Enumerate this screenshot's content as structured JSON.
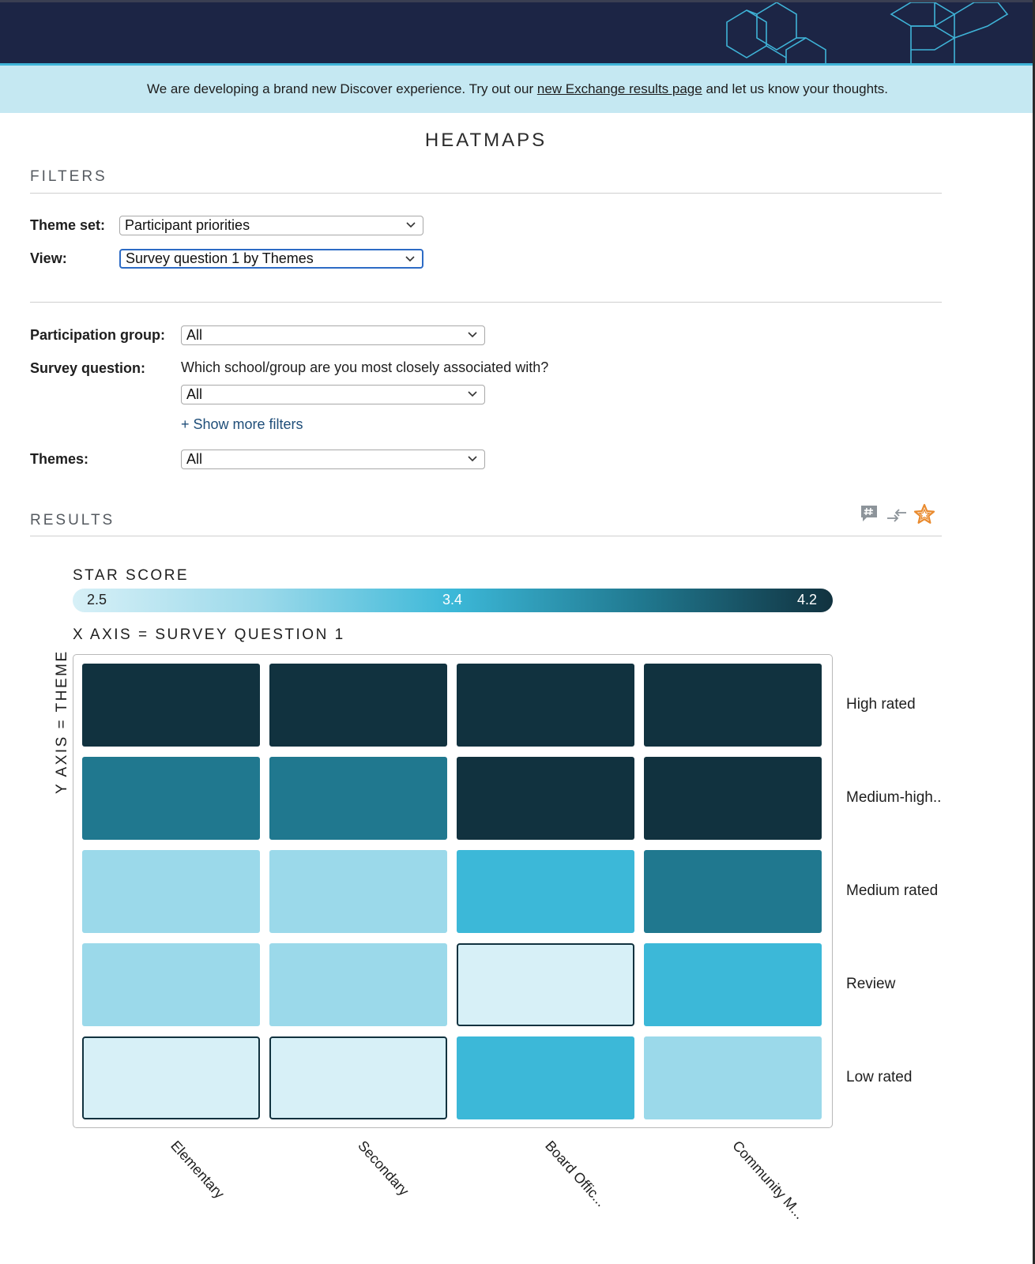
{
  "banner": {
    "text_before": "We are developing a brand new Discover experience. Try out our ",
    "link_text": "new Exchange results page",
    "text_after": " and let us know your thoughts."
  },
  "page": {
    "title": "HEATMAPS"
  },
  "filters": {
    "heading": "FILTERS",
    "theme_set": {
      "label": "Theme set:",
      "value": "Participant priorities"
    },
    "view": {
      "label": "View:",
      "value": "Survey question 1 by Themes"
    },
    "participation_group": {
      "label": "Participation group:",
      "value": "All"
    },
    "survey_question": {
      "label": "Survey question:",
      "question": "Which school/group are you most closely associated with?",
      "value": "All"
    },
    "show_more": "+ Show more filters",
    "themes": {
      "label": "Themes:",
      "value": "All"
    }
  },
  "results": {
    "heading": "RESULTS",
    "icons": [
      "comment-hashtag-icon",
      "swap-arrows-icon",
      "star-icon"
    ]
  },
  "colors": {
    "header_navy": "#1c2545",
    "banner_bg": "#c5e8f2",
    "star_orange": "#e98a2e",
    "scale": [
      "#d7f0f7",
      "#9bd9ea",
      "#3cb8d8",
      "#20788f",
      "#11323f"
    ]
  },
  "chart_data": {
    "type": "heatmap",
    "title": "STAR SCORE",
    "scale_labels": {
      "min": "2.5",
      "mid": "3.4",
      "max": "4.2"
    },
    "scale_range": [
      2.5,
      4.2
    ],
    "xlabel": "X AXIS = SURVEY QUESTION 1",
    "ylabel": "Y AXIS = THEME",
    "x": [
      "Elementary",
      "Secondary",
      "Board Offic...",
      "Community M..."
    ],
    "y": [
      "High rated",
      "Medium-high..",
      "Medium rated",
      "Review",
      "Low rated"
    ],
    "values": [
      [
        4.2,
        4.2,
        4.2,
        4.2
      ],
      [
        3.8,
        3.8,
        4.2,
        4.2
      ],
      [
        3.0,
        3.0,
        3.4,
        3.8
      ],
      [
        3.0,
        3.0,
        2.5,
        3.4
      ],
      [
        2.5,
        2.5,
        3.4,
        3.0
      ]
    ],
    "outlined": [
      [
        false,
        false,
        false,
        false
      ],
      [
        false,
        false,
        false,
        false
      ],
      [
        false,
        false,
        false,
        false
      ],
      [
        false,
        false,
        true,
        false
      ],
      [
        true,
        true,
        false,
        false
      ]
    ]
  }
}
